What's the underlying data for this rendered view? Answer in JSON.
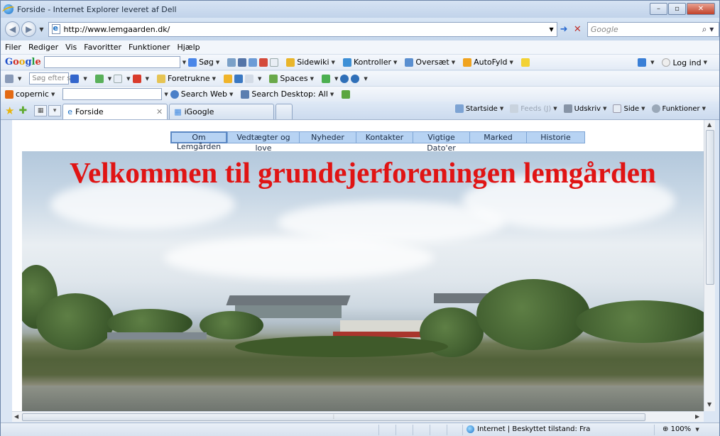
{
  "window": {
    "title": "Forside - Internet Explorer leveret af Dell"
  },
  "address": {
    "url": "http://www.lemgaarden.dk/",
    "search_placeholder": "Google"
  },
  "menu": [
    "Filer",
    "Rediger",
    "Vis",
    "Favoritter",
    "Funktioner",
    "Hjælp"
  ],
  "google_toolbar": {
    "items": [
      "Søg",
      "Sidewiki",
      "Kontroller",
      "Oversæt",
      "AutoFyld"
    ],
    "login": "Log ind"
  },
  "toolbar2": {
    "search_placeholder": "Søg efter søg",
    "favorites": "Foretrukne",
    "spaces": "Spaces"
  },
  "toolbar3": {
    "copernic": "copernic",
    "search_web": "Search Web",
    "search_desktop": "Search Desktop: All"
  },
  "tabs": [
    {
      "label": "Forside",
      "active": true
    },
    {
      "label": "iGoogle",
      "active": false
    }
  ],
  "commandbar": [
    "Startside",
    "Feeds (J)",
    "Udskriv",
    "Side",
    "Funktioner"
  ],
  "site": {
    "nav": [
      "Om Lemgården",
      "Vedtægter og love",
      "Nyheder",
      "Kontakter",
      "Vigtige Dato'er",
      "Marked",
      "Historie"
    ],
    "heading": "Velkommen til grundejerforeningen lemgården"
  },
  "statusbar": {
    "zone": "Internet | Beskyttet tilstand: Fra",
    "zoom": "100%"
  },
  "colors": {
    "heading": "#e01414",
    "nav_bg": "#b7d3f3"
  }
}
